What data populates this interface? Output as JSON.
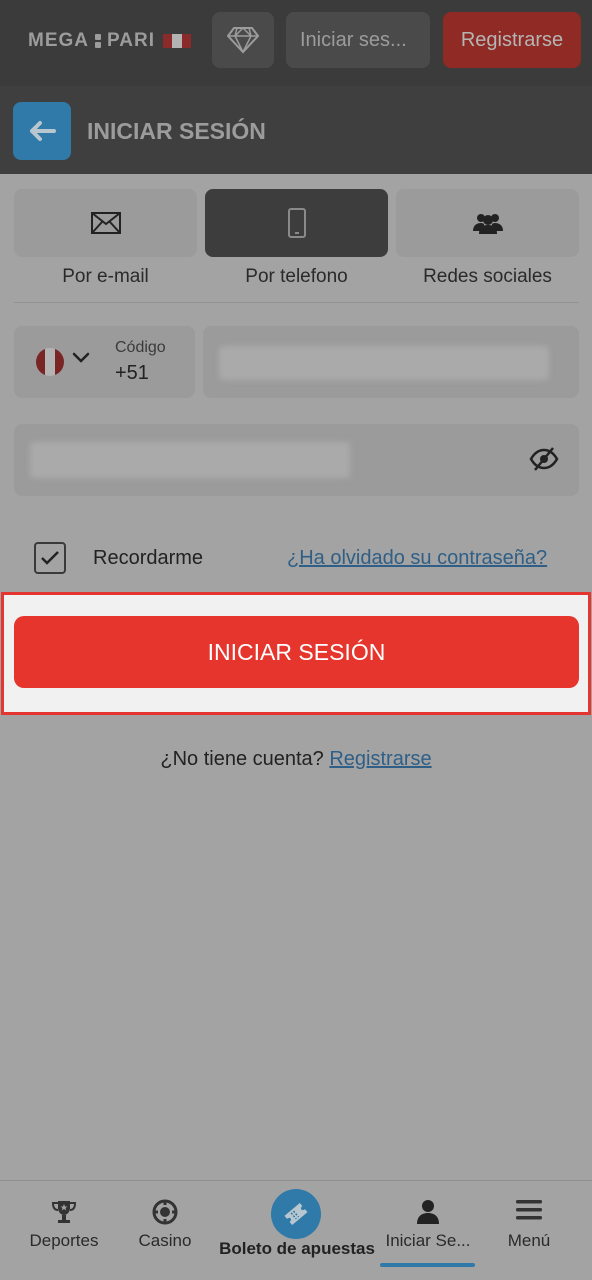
{
  "topbar": {
    "logo_left": "MEGA",
    "logo_right": "PARI",
    "login_label": "Iniciar ses...",
    "register_label": "Registrarse"
  },
  "header": {
    "title": "INICIAR SESIÓN"
  },
  "tabs": [
    {
      "label": "Por e-mail",
      "icon": "envelope-icon",
      "active": false
    },
    {
      "label": "Por telefono",
      "icon": "phone-icon",
      "active": true
    },
    {
      "label": "Redes sociales",
      "icon": "users-icon",
      "active": false
    }
  ],
  "form": {
    "country_code_label": "Código",
    "country_code_value": "+51",
    "phone_value": "",
    "password_value": "",
    "remember_label": "Recordarme",
    "remember_checked": true,
    "forgot_label": "¿Ha olvidado su contraseña?",
    "submit_label": "INICIAR SESIÓN"
  },
  "signup": {
    "question": "¿No tiene cuenta?",
    "link": "Registrarse"
  },
  "bottom_nav": {
    "items": [
      {
        "label": "Deportes",
        "icon": "trophy-icon"
      },
      {
        "label": "Casino",
        "icon": "casino-chip-icon"
      },
      {
        "label": "Boleto de apuestas",
        "icon": "ticket-icon"
      },
      {
        "label": "Iniciar Se...",
        "icon": "user-icon",
        "active": true
      },
      {
        "label": "Menú",
        "icon": "menu-icon"
      }
    ]
  },
  "colors": {
    "accent_red": "#e5352c",
    "accent_blue": "#2f7aa8",
    "link_blue": "#2f5f86"
  }
}
